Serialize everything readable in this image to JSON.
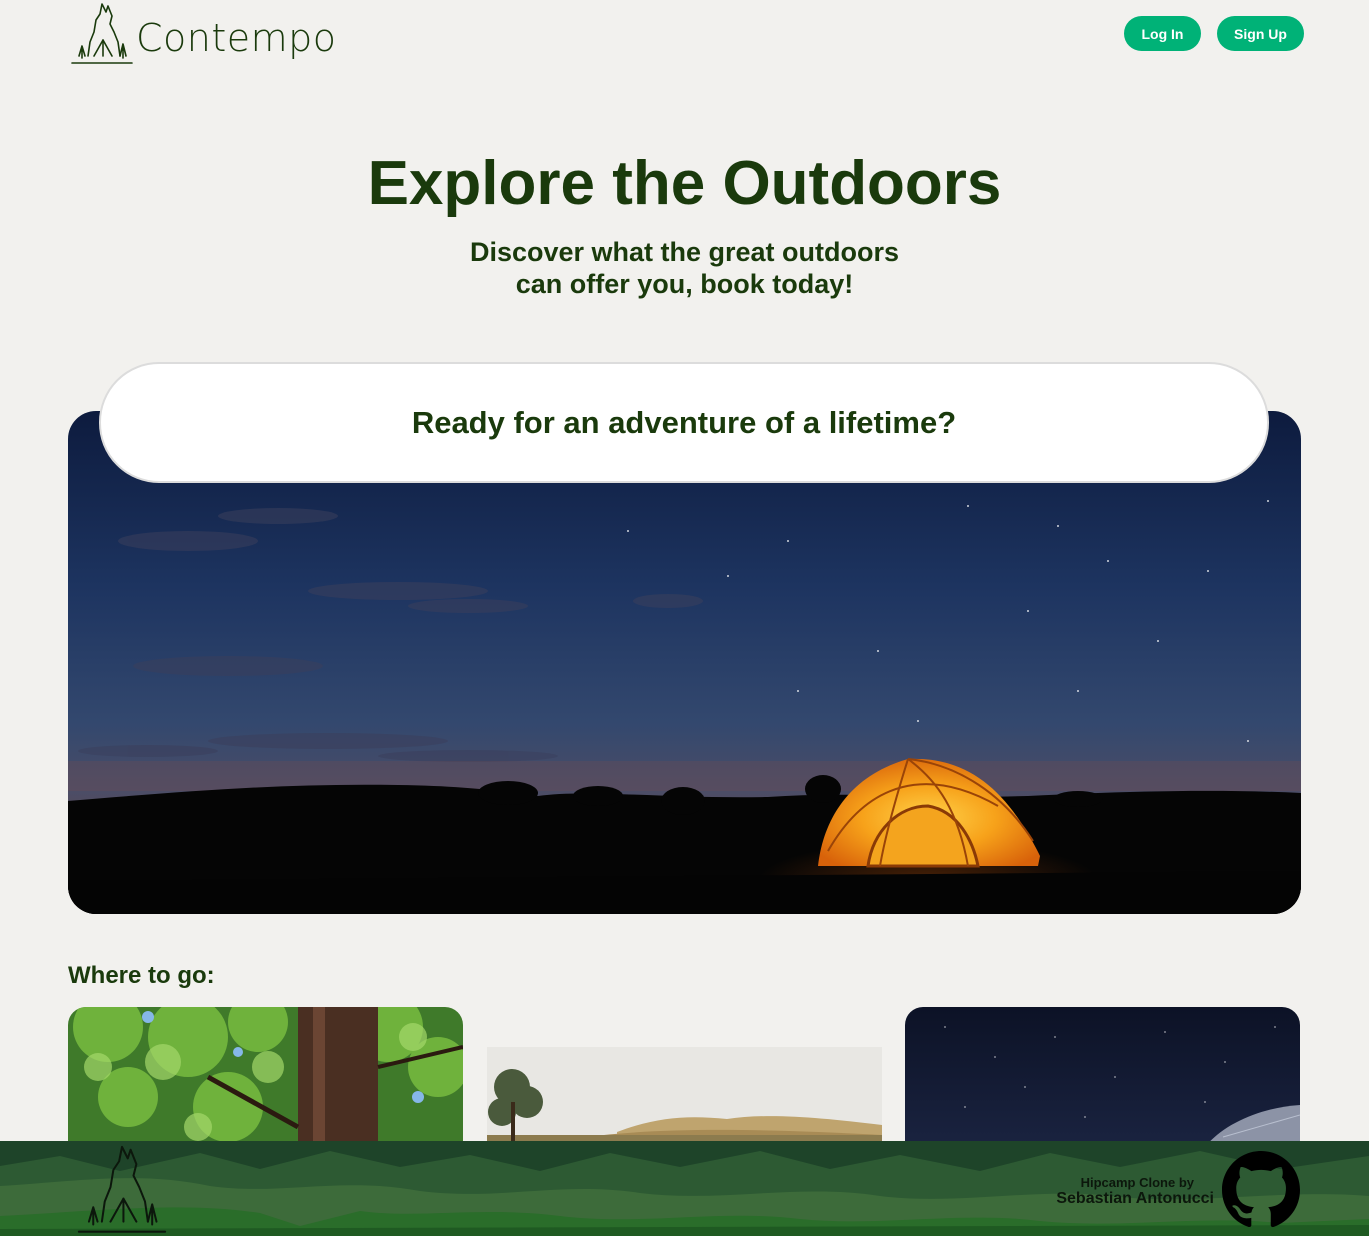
{
  "header": {
    "brand": "Contempo",
    "login_label": "Log In",
    "signup_label": "Sign Up"
  },
  "hero": {
    "title": "Explore the Outdoors",
    "subtitle_line1": "Discover what the great outdoors",
    "subtitle_line2": "can offer you, book today!",
    "banner_text": "Ready for an adventure of a lifetime?"
  },
  "destinations": {
    "heading": "Where to go:"
  },
  "footer": {
    "credit_line1": "Hipcamp Clone by",
    "credit_line2": "Sebastian Antonucci"
  },
  "colors": {
    "brand_green": "#1a3a0c",
    "button_green": "#00b277",
    "page_bg": "#f2f1ee",
    "footer_green": "#1e4429"
  },
  "icons": [
    "wolf-tent-logo-icon",
    "github-icon"
  ]
}
